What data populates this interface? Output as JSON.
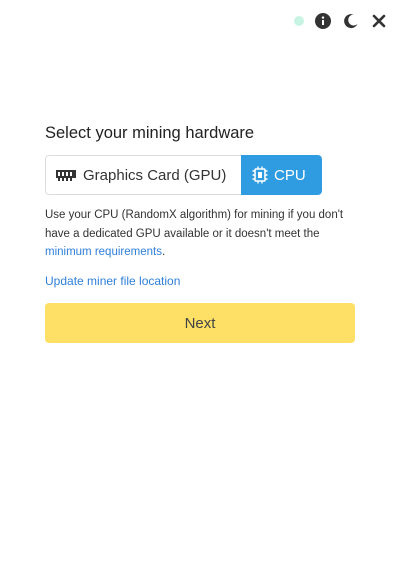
{
  "header": {
    "icons": [
      "status-dot",
      "info-icon",
      "moon-icon",
      "close-icon"
    ],
    "status_color": "#c8f5e3"
  },
  "title": "Select your mining hardware",
  "hardware": {
    "options": [
      {
        "label": "Graphics Card (GPU)",
        "icon": "gpu-card-icon",
        "selected": false
      },
      {
        "label": "CPU",
        "icon": "cpu-chip-icon",
        "selected": true
      }
    ],
    "selected_color": "#2f9be0"
  },
  "description": {
    "text": "Use your CPU (RandomX algorithm) for mining if you don't have a dedicated GPU available or it doesn't meet the ",
    "link_text": "minimum requirements",
    "suffix": "."
  },
  "update_link": "Update miner file location",
  "next_button": {
    "label": "Next",
    "color": "#ffe066"
  }
}
